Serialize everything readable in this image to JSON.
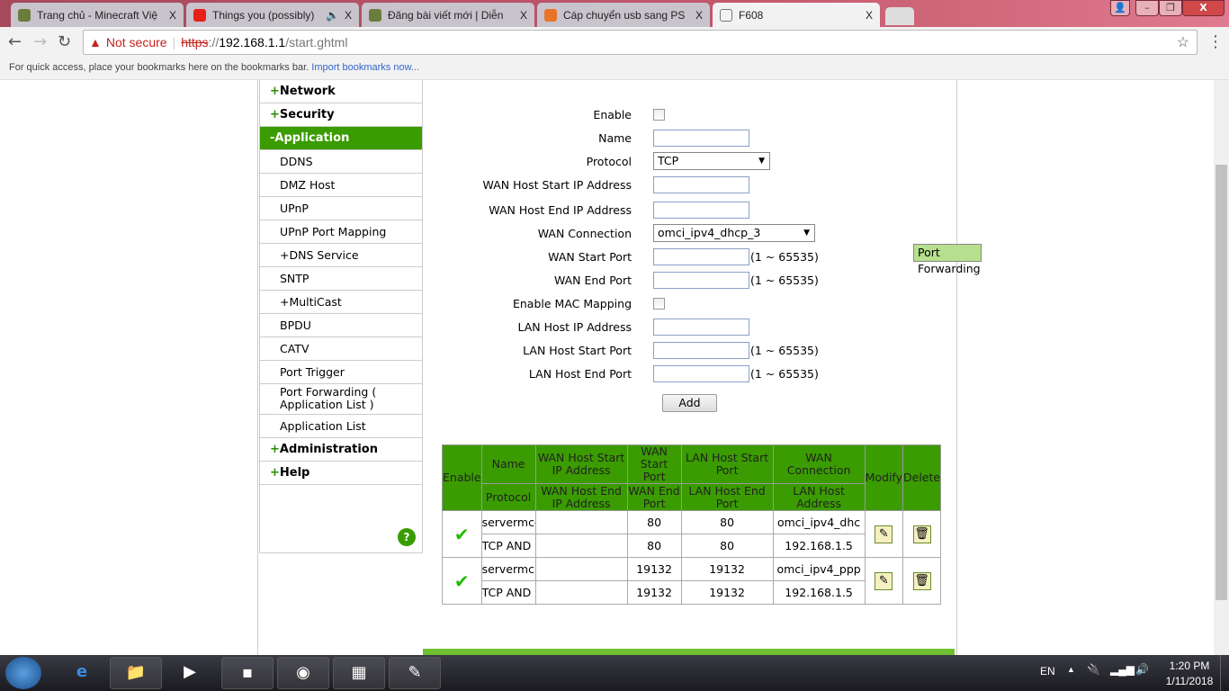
{
  "browser": {
    "tabs": [
      {
        "title": "Trang chủ - Minecraft Việ",
        "color": "#6b7d3a"
      },
      {
        "title": "Things you (possibly)",
        "color": "#e62117"
      },
      {
        "title": "Đăng bài viết mới | Diễn",
        "color": "#6b7d3a"
      },
      {
        "title": "Cáp chuyển usb sang PS",
        "color": "#e8742a"
      },
      {
        "title": "F608",
        "color": "#ffffff"
      }
    ],
    "close": "X",
    "not_secure": "Not secure",
    "url_scheme": "https",
    "url_host": "192.168.1.1",
    "url_path": "/start.ghtml",
    "bookmarks_text": "For quick access, place your bookmarks here on the bookmarks bar.",
    "import_link": "Import bookmarks now..."
  },
  "sidebar": {
    "top": [
      {
        "sign": "+",
        "label": "Network"
      },
      {
        "sign": "+",
        "label": "Security"
      }
    ],
    "open": {
      "sign": "-",
      "label": "Application"
    },
    "items": [
      "DDNS",
      "DMZ Host",
      "UPnP",
      "UPnP Port Mapping",
      "Port Forwarding",
      "+DNS Service",
      "SNTP",
      "+MultiCast",
      "BPDU",
      "CATV",
      "Port Trigger",
      "Port Forwarding ( Application List )",
      "Application List"
    ],
    "bottom": [
      {
        "sign": "+",
        "label": "Administration"
      },
      {
        "sign": "+",
        "label": "Help"
      }
    ],
    "help": "?"
  },
  "form": {
    "enable": "Enable",
    "name": "Name",
    "protocol": "Protocol",
    "protocol_value": "TCP",
    "wan_host_start": "WAN Host Start IP Address",
    "wan_host_end": "WAN Host End IP Address",
    "wan_connection": "WAN Connection",
    "wan_connection_value": "omci_ipv4_dhcp_3",
    "wan_start_port": "WAN Start Port",
    "wan_end_port": "WAN End Port",
    "enable_mac": "Enable MAC Mapping",
    "lan_host_ip": "LAN Host IP Address",
    "lan_start_port": "LAN Host Start Port",
    "lan_end_port": "LAN Host End Port",
    "range": "(1 ~ 65535)",
    "add": "Add"
  },
  "table": {
    "h_enable": "Enable",
    "h_name": "Name",
    "h_protocol": "Protocol",
    "h_wan_start_ip": "WAN Host Start IP Address",
    "h_wan_end_ip": "WAN Host End IP Address",
    "h_wan_start_port": "WAN Start Port",
    "h_wan_end_port": "WAN End Port",
    "h_lan_start_port": "LAN Host Start Port",
    "h_lan_end_port": "LAN Host End Port",
    "h_wan_conn": "WAN Connection",
    "h_lan_addr": "LAN Host Address",
    "h_modify": "Modify",
    "h_delete": "Delete",
    "rows": [
      {
        "enabled": "✔",
        "name": "servermcc",
        "protocol": "TCP AND UDP",
        "wan_start_ip": "",
        "wan_end_ip": "",
        "wan_start_port": "80",
        "wan_end_port": "80",
        "lan_start_port": "80",
        "lan_end_port": "80",
        "wan_conn": "omci_ipv4_dhc",
        "lan_addr": "192.168.1.5"
      },
      {
        "enabled": "✔",
        "name": "servermc",
        "protocol": "TCP AND UDP",
        "wan_start_ip": "",
        "wan_end_ip": "",
        "wan_start_port": "19132",
        "wan_end_port": "19132",
        "lan_start_port": "19132",
        "lan_end_port": "19132",
        "wan_conn": "omci_ipv4_ppp",
        "lan_addr": "192.168.1.5"
      }
    ]
  },
  "taskbar": {
    "lang": "EN",
    "time": "1:20 PM",
    "date": "1/11/2018"
  }
}
